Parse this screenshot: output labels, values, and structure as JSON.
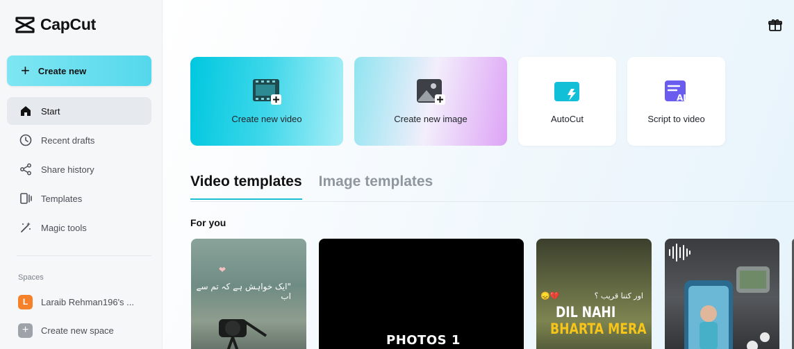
{
  "app": {
    "name": "CapCut"
  },
  "sidebar": {
    "create_label": "Create new",
    "items": [
      {
        "label": "Start",
        "icon": "home-icon",
        "active": true
      },
      {
        "label": "Recent drafts",
        "icon": "clock-icon"
      },
      {
        "label": "Share history",
        "icon": "share-icon"
      },
      {
        "label": "Templates",
        "icon": "templates-icon"
      },
      {
        "label": "Magic tools",
        "icon": "magic-wand-icon"
      }
    ],
    "spaces_title": "Spaces",
    "spaces": [
      {
        "avatar": "L",
        "label": "Laraib Rehman196's ..."
      }
    ],
    "create_space_label": "Create new space"
  },
  "cards": {
    "video": "Create new video",
    "image": "Create new image",
    "autocut": "AutoCut",
    "script": "Script to video"
  },
  "tabs": [
    {
      "label": "Video templates",
      "active": true
    },
    {
      "label": "Image templates",
      "active": false
    }
  ],
  "section_title": "For you",
  "thumbnails": {
    "t1_text": "\"ایک خواہش ہے کہ تم سے اب",
    "t2_text": "PHOTOS 1",
    "t3_urdu": "اور کتنا قریب ؟",
    "t3_line1": "DIL NAHI",
    "t3_line2": "BHARTA MERA"
  },
  "colors": {
    "accent": "#19bfd0",
    "space_avatar": "#f5822a"
  }
}
